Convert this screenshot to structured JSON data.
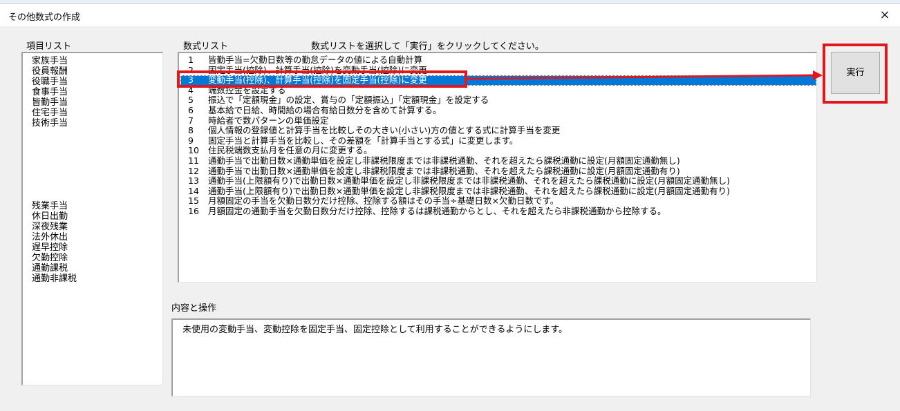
{
  "window": {
    "title": "その他数式の作成",
    "close_icon": "×"
  },
  "item_list": {
    "label": "項目リスト",
    "group1": [
      "家族手当",
      "役員報酬",
      "役職手当",
      "食事手当",
      "皆勤手当",
      "住宅手当",
      "技術手当"
    ],
    "group2": [
      "残業手当",
      "休日出勤",
      "深夜残業",
      "法外休出",
      "遅早控除",
      "欠勤控除",
      "通勤課税",
      "通勤非課税"
    ]
  },
  "formula_list": {
    "label": "数式リスト",
    "instruction": "数式リストを選択して「実行」をクリックしてください。",
    "selected_index": 3,
    "items": [
      {
        "num": "1",
        "text": "皆勤手当=欠勤日数等の勤怠データの値による自動計算"
      },
      {
        "num": "2",
        "text": "固定手当(控除)、計算手当(控除)を変動手当(控除)に変更"
      },
      {
        "num": "3",
        "text": "変動手当(控除)、計算手当(控除)を固定手当(控除)に変更"
      },
      {
        "num": "4",
        "text": "端数控金を設定する"
      },
      {
        "num": "5",
        "text": "振込で「定額現金」の設定、賞与の「定額振込」「定額現金」を設定する"
      },
      {
        "num": "6",
        "text": "基本給で日給、時間給の場合有給日数分を含めて計算する。"
      },
      {
        "num": "7",
        "text": "時給者で数パターンの単価設定"
      },
      {
        "num": "8",
        "text": "個人情報の登録値と計算手当を比較しその大きい(小さい)方の値とする式に計算手当を変更"
      },
      {
        "num": "9",
        "text": "固定手当と計算手当を比較し、その差額を「計算手当とする式」に変更します。"
      },
      {
        "num": "10",
        "text": "住民税端数支払月を任意の月に変更する。"
      },
      {
        "num": "11",
        "text": "通勤手当で出勤日数×通勤単価を設定し非課税限度までは非課税通勤、それを超えたら課税通勤に設定(月額固定通勤無し)"
      },
      {
        "num": "12",
        "text": "通勤手当で出勤日数×通勤単価を設定し非課税限度までは非課税通勤、それを超えたら課税通勤に設定(月額固定通勤有り)"
      },
      {
        "num": "13",
        "text": "通勤手当(上限額有り)で出勤日数×通勤単価を設定し非課税限度までは非課税通勤、それを超えたら課税通勤に設定(月額固定通勤無し)"
      },
      {
        "num": "14",
        "text": "通勤手当(上限額有り)で出勤日数×通勤単価を設定し非課税限度までは非課税通勤、それを超えたら課税通勤に設定(月額固定通勤有り)"
      },
      {
        "num": "15",
        "text": "月額固定の手当を欠勤日数分だけ控除、控除する額はその手当÷基礎日数×欠勤日数です。"
      },
      {
        "num": "16",
        "text": "月額固定の通勤手当を欠勤日数分だけ控除、控除するは課税通勤からとし、それを超えたら非課税通勤から控除する。"
      }
    ]
  },
  "description": {
    "label": "内容と操作",
    "text": "未使用の変動手当、変動控除を固定手当、固定控除として利用することができるようにします。"
  },
  "execute_button": {
    "label": "実行"
  },
  "colors": {
    "selection": "#0078d7",
    "highlight": "#e0171f"
  }
}
